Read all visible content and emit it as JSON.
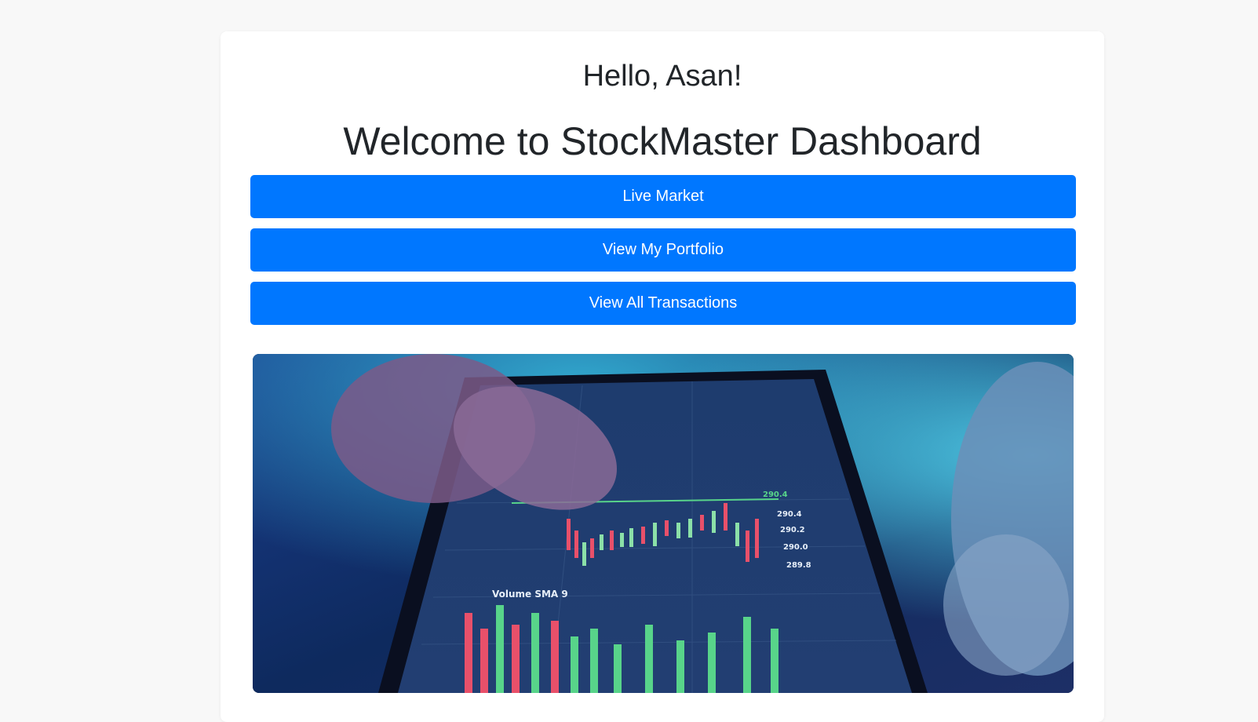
{
  "header": {
    "greeting": "Hello, Asan!",
    "headline": "Welcome to StockMaster Dashboard"
  },
  "actions": [
    {
      "label": "Live Market"
    },
    {
      "label": "View My Portfolio"
    },
    {
      "label": "View All Transactions"
    }
  ],
  "hero_image": {
    "screen_labels": [
      "290.4",
      "290.2",
      "290.0",
      "289.8",
      "Volume SMA 9"
    ]
  },
  "colors": {
    "page_bg": "#f8f8f8",
    "card_bg": "#ffffff",
    "button_bg": "#0077ff",
    "button_text": "#ffffff",
    "heading_text": "#212529"
  }
}
